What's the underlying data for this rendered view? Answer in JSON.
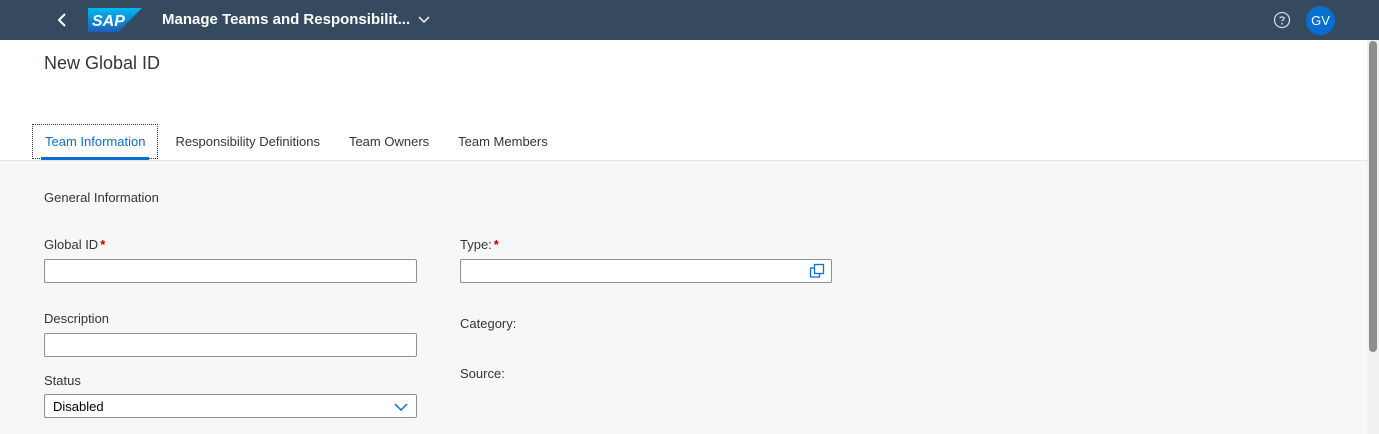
{
  "shell": {
    "logo_text": "SAP",
    "app_title": "Manage Teams and Responsibilit...",
    "avatar_initials": "GV"
  },
  "header": {
    "page_title": "New Global ID"
  },
  "tabs": [
    {
      "label": "Team Information",
      "active": true
    },
    {
      "label": "Responsibility Definitions",
      "active": false
    },
    {
      "label": "Team Owners",
      "active": false
    },
    {
      "label": "Team Members",
      "active": false
    }
  ],
  "form": {
    "section_title": "General Information",
    "global_id_label": "Global ID",
    "global_id_value": "",
    "type_label": "Type:",
    "type_value": "",
    "description_label": "Description",
    "description_value": "",
    "category_label": "Category:",
    "source_label": "Source:",
    "status_label": "Status",
    "status_value": "Disabled",
    "required_marker": "*"
  },
  "colors": {
    "shell_bg": "#354a5f",
    "accent": "#0a6ed1",
    "required": "#bb0000"
  }
}
